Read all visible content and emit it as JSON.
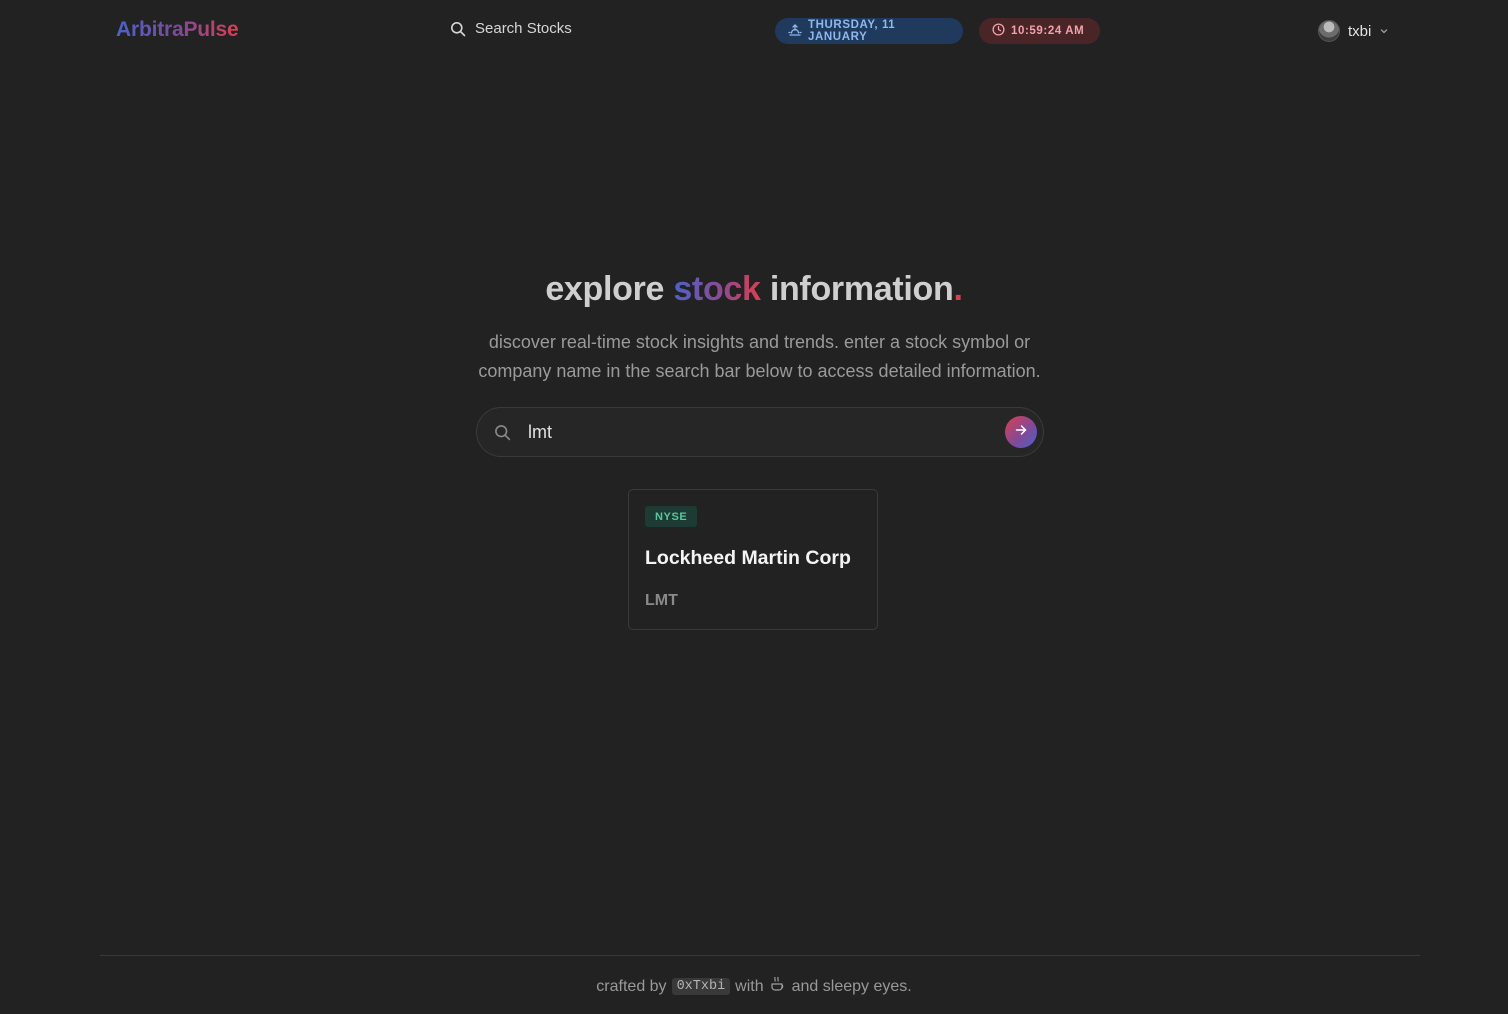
{
  "header": {
    "logo": "ArbitraPulse",
    "search_label": "Search Stocks",
    "date_pill": "THURSDAY, 11 JANUARY",
    "time_pill": "10:59:24 AM",
    "user_name": "txbi",
    "icons": {
      "search": "search-icon",
      "date": "sunrise-icon",
      "time": "clock-icon",
      "user_menu": "chevron-down-icon"
    },
    "colors": {
      "date_pill_bg": "#1f3a5c",
      "date_pill_text": "#8fb8ec",
      "time_pill_bg": "#4a2528",
      "time_pill_text": "#f0a3a8"
    }
  },
  "hero": {
    "title_prefix": "explore",
    "title_highlight": "stock",
    "title_suffix": "information",
    "title_dot": ".",
    "description": "discover real-time stock insights and trends. enter a stock symbol or company name in the search bar below to access detailed information."
  },
  "search": {
    "value": "lmt",
    "submit_icon": "arrow-right-icon"
  },
  "results": [
    {
      "exchange": "NYSE",
      "name": "Lockheed Martin Corp",
      "symbol": "LMT"
    }
  ],
  "footer": {
    "prefix": "crafted by",
    "handle": "0xTxbi",
    "middle": "with",
    "icon": "coffee-icon",
    "suffix": "and sleepy eyes."
  },
  "theme": {
    "background": "#222222",
    "accent_blue": "#4a63c9",
    "accent_red": "#d9404f",
    "exchange_badge": "#58c79e"
  }
}
